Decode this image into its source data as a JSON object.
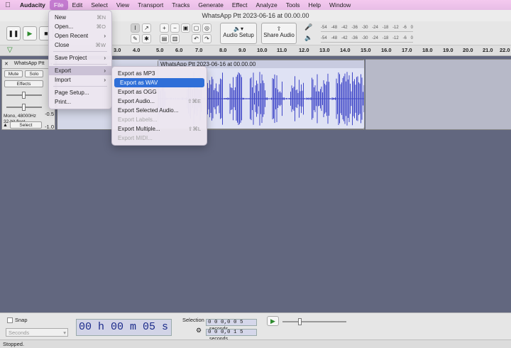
{
  "menubar": {
    "apple_icon": "apple-icon",
    "items": [
      "Audacity",
      "File",
      "Edit",
      "Select",
      "View",
      "Transport",
      "Tracks",
      "Generate",
      "Effect",
      "Analyze",
      "Tools",
      "Help",
      "Window"
    ]
  },
  "window": {
    "title": "WhatsApp Ptt 2023-06-16 at 00.00.00"
  },
  "toolbar": {
    "audio_setup": "Audio Setup",
    "share_audio": "Share Audio",
    "meter_ticks": [
      "-54",
      "-48",
      "-42",
      "-36",
      "-30",
      "-24",
      "-18",
      "-12",
      "-6",
      "0"
    ]
  },
  "ruler": {
    "ticks": [
      "3.0",
      "4.0",
      "5.0",
      "6.0",
      "7.0",
      "8.0",
      "9.0",
      "10.0",
      "11.0",
      "12.0",
      "13.0",
      "14.0",
      "15.0",
      "16.0",
      "17.0",
      "18.0",
      "19.0",
      "20.0",
      "21.0",
      "22.0"
    ]
  },
  "track": {
    "name": "WhatsApp Ptt",
    "mute": "Mute",
    "solo": "Solo",
    "effects": "Effects",
    "info": "Mono, 48000Hz",
    "format": "32-bit float",
    "select": "Select",
    "scale": [
      "-0.5",
      "-1.0"
    ],
    "clip_title": "WhatsApp Ptt 2023-06-16 at 00.00.00"
  },
  "file_menu": {
    "items": [
      {
        "label": "New",
        "shortcut": "⌘N"
      },
      {
        "label": "Open...",
        "shortcut": "⌘O"
      },
      {
        "label": "Open Recent",
        "shortcut": "›"
      },
      {
        "label": "Close",
        "shortcut": "⌘W"
      },
      {
        "label": "Save Project",
        "shortcut": "›"
      },
      {
        "label": "Export",
        "shortcut": "›"
      },
      {
        "label": "Import",
        "shortcut": "›"
      },
      {
        "label": "Page Setup...",
        "shortcut": ""
      },
      {
        "label": "Print...",
        "shortcut": ""
      }
    ]
  },
  "export_menu": {
    "items": [
      {
        "label": "Export as MP3",
        "shortcut": ""
      },
      {
        "label": "Export as WAV",
        "shortcut": ""
      },
      {
        "label": "Export as OGG",
        "shortcut": ""
      },
      {
        "label": "Export Audio...",
        "shortcut": "⇧⌘E"
      },
      {
        "label": "Export Selected Audio...",
        "shortcut": ""
      },
      {
        "label": "Export Labels...",
        "shortcut": ""
      },
      {
        "label": "Export Multiple...",
        "shortcut": "⇧⌘L"
      },
      {
        "label": "Export MIDI...",
        "shortcut": ""
      }
    ]
  },
  "bottom": {
    "snap": "Snap",
    "snap_unit": "Seconds",
    "time": "00 h 00 m 05 s",
    "selection_label": "Selection",
    "sel_start": "0 0 0,0 0 5",
    "sel_start_unit": "seconds",
    "sel_end": "0 0 0,0 1 5",
    "sel_end_unit": "seconds"
  },
  "status": "Stopped.",
  "colors": {
    "menubar": "#f0c6ee",
    "waveform": "#3f47c8",
    "background": "#62677f",
    "highlight": "#2f6fd8"
  }
}
